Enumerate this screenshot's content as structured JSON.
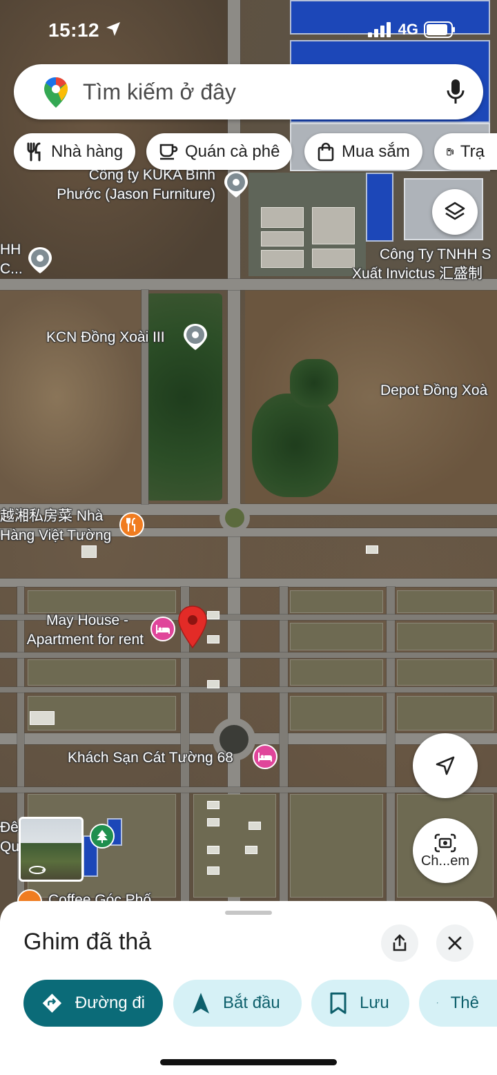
{
  "status_bar": {
    "time": "15:12",
    "network": "4G"
  },
  "search": {
    "placeholder": "Tìm kiếm ở đây"
  },
  "chips": [
    {
      "label": "Nhà hàng",
      "icon": "fork-knife-icon"
    },
    {
      "label": "Quán cà phê",
      "icon": "coffee-cup-icon"
    },
    {
      "label": "Mua sắm",
      "icon": "shopping-bag-icon"
    },
    {
      "label": "Trạ",
      "icon": "gas-station-icon"
    }
  ],
  "map_labels": {
    "kuka_line1": "Công ty KUKA Bình",
    "kuka_line2": "Phước (Jason Furniture)",
    "tnhh_left_line1": "HH",
    "tnhh_left_line2": "C...",
    "invictus_line1": "Công Ty TNHH S",
    "invictus_line2": "Xuất Invictus 汇盛制",
    "kcn": "KCN Đồng Xoài III",
    "depot": "Depot Đồng Xoà",
    "restaurant_line1": "越湘私房菜 Nhà",
    "restaurant_line2": "Hàng Việt Tường",
    "mayhouse_line1": "May House -",
    "mayhouse_line2": "Apartment for rent",
    "hotel": "Khách Sạn Cát Tường 68",
    "dem_line1": "Đêm",
    "dem_line2": "Qua",
    "coffee_partial": "Coffee Góc Phố"
  },
  "camera_button": {
    "label": "Ch...em"
  },
  "sheet": {
    "title": "Ghim đã thả",
    "actions": [
      {
        "label": "Đường đi",
        "icon": "directions-icon"
      },
      {
        "label": "Bắt đầu",
        "icon": "navigation-arrow-icon"
      },
      {
        "label": "Lưu",
        "icon": "bookmark-icon"
      },
      {
        "label": "Thê",
        "icon": "flag-icon"
      }
    ]
  },
  "colors": {
    "primary_action": "#0b6b78",
    "secondary_action": "#d6f1f6",
    "dropped_pin": "#e32b27",
    "hotel_poi": "#e0459a",
    "restaurant_poi": "#f07c20",
    "park_poi": "#1f8f4e"
  }
}
